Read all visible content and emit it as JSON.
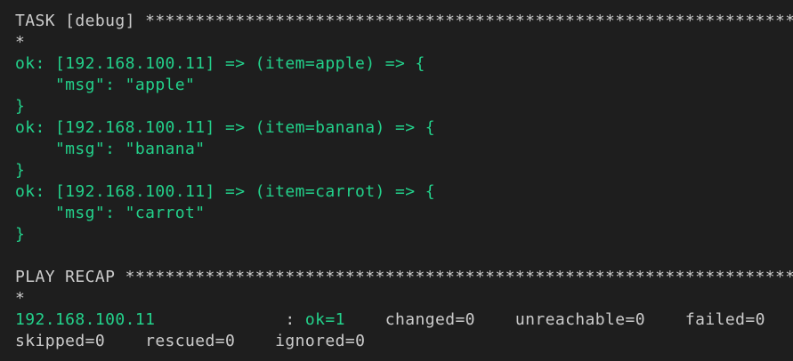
{
  "colors": {
    "background": "#1e1e1e",
    "default_text": "#cccccc",
    "ok_green": "#23d18b"
  },
  "task_block": {
    "header": "TASK [debug] *************************************************************************",
    "header_cont": "*",
    "results": [
      {
        "open": "ok: [192.168.100.11] => (item=apple) => {",
        "msg": "    \"msg\": \"apple\"",
        "close": "}"
      },
      {
        "open": "ok: [192.168.100.11] => (item=banana) => {",
        "msg": "    \"msg\": \"banana\"",
        "close": "}"
      },
      {
        "open": "ok: [192.168.100.11] => (item=carrot) => {",
        "msg": "    \"msg\": \"carrot\"",
        "close": "}"
      }
    ]
  },
  "recap": {
    "header": "PLAY RECAP *************************************************************************",
    "header_cont": "*",
    "host": "192.168.100.11",
    "sep": "             : ",
    "ok": "ok=1",
    "changed": "    changed=0",
    "unreachable": "    unreachable=0",
    "failed": "    failed=0",
    "skipped": "skipped=0",
    "rescued": "    rescued=0",
    "ignored": "    ignored=0"
  }
}
